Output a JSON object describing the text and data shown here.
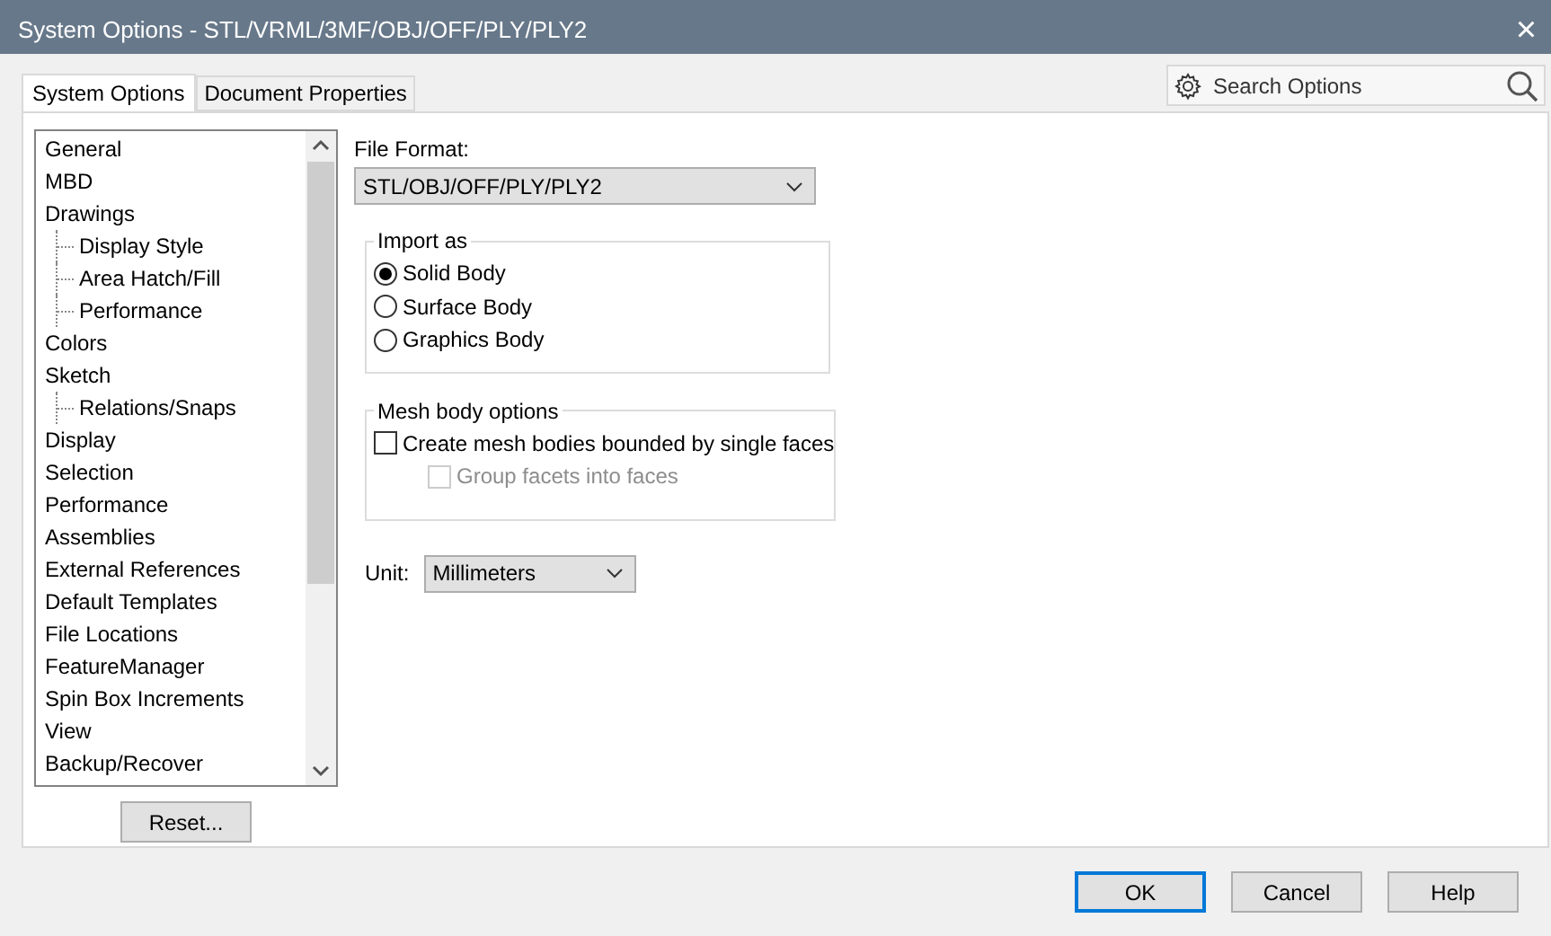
{
  "window": {
    "title": "System Options - STL/VRML/3MF/OBJ/OFF/PLY/PLY2",
    "close": "×"
  },
  "tabs": [
    {
      "label": "System Options",
      "selected": true
    },
    {
      "label": "Document Properties",
      "selected": false
    }
  ],
  "search": {
    "placeholder": "Search Options"
  },
  "sidebar": {
    "items": [
      {
        "label": "General"
      },
      {
        "label": "MBD"
      },
      {
        "label": "Drawings",
        "children": [
          {
            "label": "Display Style"
          },
          {
            "label": "Area Hatch/Fill"
          },
          {
            "label": "Performance"
          }
        ]
      },
      {
        "label": "Colors"
      },
      {
        "label": "Sketch",
        "children": [
          {
            "label": "Relations/Snaps"
          }
        ]
      },
      {
        "label": "Display"
      },
      {
        "label": "Selection"
      },
      {
        "label": "Performance"
      },
      {
        "label": "Assemblies"
      },
      {
        "label": "External References"
      },
      {
        "label": "Default Templates"
      },
      {
        "label": "File Locations"
      },
      {
        "label": "FeatureManager"
      },
      {
        "label": "Spin Box Increments"
      },
      {
        "label": "View"
      },
      {
        "label": "Backup/Recover"
      }
    ],
    "reset_button": "Reset..."
  },
  "file_format": {
    "label": "File Format:",
    "value": "STL/OBJ/OFF/PLY/PLY2"
  },
  "import_as": {
    "title": "Import as",
    "options": [
      {
        "label": "Solid Body",
        "selected": true
      },
      {
        "label": "Surface Body",
        "selected": false
      },
      {
        "label": "Graphics Body",
        "selected": false
      }
    ]
  },
  "mesh_options": {
    "title": "Mesh body options",
    "checkboxes": [
      {
        "label": "Create mesh bodies bounded by single faces",
        "checked": false,
        "disabled": false,
        "indent": false
      },
      {
        "label": "Group facets into faces",
        "checked": false,
        "disabled": true,
        "indent": true
      }
    ]
  },
  "unit": {
    "label": "Unit:",
    "value": "Millimeters"
  },
  "buttons": [
    {
      "label": "OK",
      "default": true
    },
    {
      "label": "Cancel",
      "default": false
    },
    {
      "label": "Help",
      "default": false
    }
  ]
}
